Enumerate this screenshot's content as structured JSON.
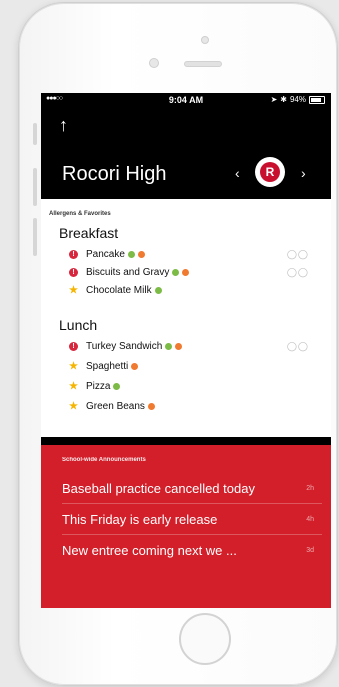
{
  "status_bar": {
    "carrier": "●●●○○",
    "time": "9:04 AM",
    "battery": "94%"
  },
  "header": {
    "back_icon": "arrow-up-icon",
    "school_name": "Rocori High",
    "prev": "‹",
    "next": "›",
    "logo_text": "R"
  },
  "menu": {
    "section_label": "Allergens & Favorites",
    "breakfast": {
      "title": "Breakfast",
      "items": [
        {
          "marker": "allergen",
          "name": "Pancake",
          "tags": [
            "G",
            "O"
          ],
          "drops": "◯◯"
        },
        {
          "marker": "allergen",
          "name": "Biscuits and Gravy",
          "tags": [
            "G",
            "O"
          ],
          "drops": "◯◯"
        },
        {
          "marker": "star",
          "name": "Chocolate Milk",
          "tags": [
            "G"
          ]
        }
      ]
    },
    "lunch": {
      "title": "Lunch",
      "items": [
        {
          "marker": "allergen",
          "name": "Turkey Sandwich",
          "tags": [
            "G",
            "O"
          ],
          "drops": "◯◯"
        },
        {
          "marker": "star",
          "name": "Spaghetti",
          "tags": [
            "O"
          ]
        },
        {
          "marker": "star",
          "name": "Pizza",
          "tags": [
            "G"
          ]
        },
        {
          "marker": "star",
          "name": "Green Beans",
          "tags": [
            "O"
          ]
        }
      ]
    }
  },
  "announcements": {
    "label": "School-wide Announcements",
    "items": [
      {
        "text": "Baseball practice cancelled today",
        "age": "2h"
      },
      {
        "text": "This Friday is early release",
        "age": "4h"
      },
      {
        "text": "New entree coming next we ...",
        "age": "3d"
      }
    ]
  },
  "colors": {
    "red": "#d21f2a",
    "allergen": "#d7263d",
    "gluten": "#7dbb47",
    "other": "#f07a2f",
    "star": "#f4b400"
  }
}
